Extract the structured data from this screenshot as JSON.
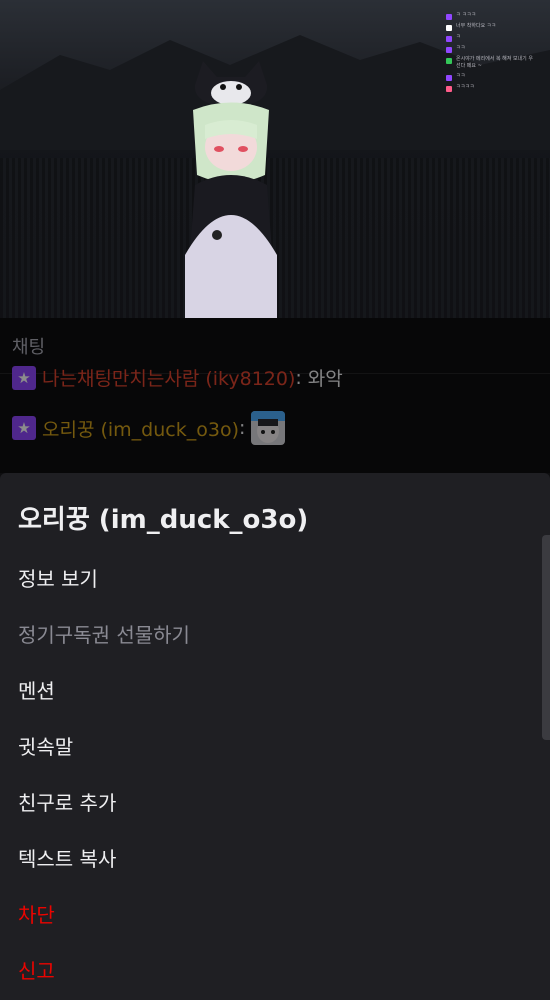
{
  "stream": {
    "overlay_chat": [
      {
        "text": "ㅋ ㅋㅋㅋ",
        "badge_color": "#9147ff"
      },
      {
        "text": "너무 착하다요 ㅋㅋ",
        "badge_color": "#ffffff"
      },
      {
        "text": "ㅋ",
        "badge_color": "#9147ff"
      },
      {
        "text": "ㅋㅋ",
        "badge_color": "#9147ff"
      },
      {
        "text": "온시야가 메리에서 복 해져 보내기 우선다 떼요 ~",
        "badge_color": "#34c759"
      },
      {
        "text": "ㅋㅋ",
        "badge_color": "#9147ff"
      },
      {
        "text": "ㅋㅋㅋㅋ",
        "badge_color": "#ff5c8a"
      }
    ]
  },
  "chat": {
    "header": "채팅",
    "messages": [
      {
        "username": "나는채팅만치는사람 (iky8120)",
        "separator": ":",
        "message": "와악",
        "username_color": "#e0442f"
      },
      {
        "username": "오리꿍 (im_duck_o3o)",
        "separator": ":",
        "message": "",
        "username_color": "#d4a21b",
        "emote": "emote"
      }
    ]
  },
  "sheet": {
    "title": "오리꿍 (im_duck_o3o)",
    "items": [
      {
        "label": "정보 보기",
        "state": "normal"
      },
      {
        "label": "정기구독권 선물하기",
        "state": "disabled"
      },
      {
        "label": "멘션",
        "state": "normal"
      },
      {
        "label": "귓속말",
        "state": "normal"
      },
      {
        "label": "친구로 추가",
        "state": "normal"
      },
      {
        "label": "텍스트 복사",
        "state": "normal"
      },
      {
        "label": "차단",
        "state": "danger"
      },
      {
        "label": "신고",
        "state": "danger"
      }
    ]
  },
  "colors": {
    "accent": "#9147ff",
    "danger": "#eb0400",
    "sheet_bg": "#1f1f23",
    "text": "#efeff1"
  }
}
